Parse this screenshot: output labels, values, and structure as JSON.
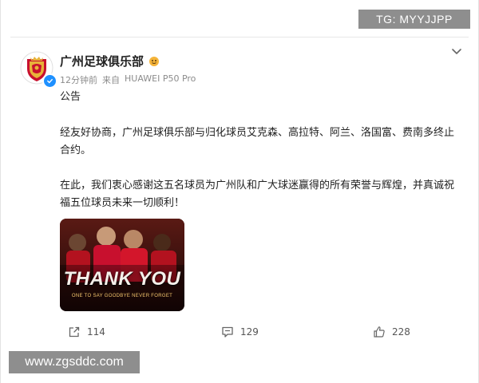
{
  "watermarks": {
    "tg": "TG: MYYJJPP",
    "site": "www.zgsddc.com"
  },
  "post": {
    "username": "广州足球俱乐部",
    "time": "12分钟前",
    "source_prefix": "来自",
    "device": "HUAWEI P50 Pro",
    "title": "公告",
    "paragraph1": "经友好协商，广州足球俱乐部与归化球员艾克森、高拉特、阿兰、洛国富、费南多终止合约。",
    "paragraph2": "在此，我们衷心感谢这五名球员为广州队和广大球迷赢得的所有荣誉与辉煌，并真诚祝福五位球员未来一切顺利！",
    "image": {
      "banner": "THANK YOU",
      "subtitle": "ONE TO SAY GOODBYE   NEVER FORGET"
    }
  },
  "actions": {
    "repost_count": "114",
    "comment_count": "129",
    "like_count": "228"
  },
  "icons": {
    "repost": "share-icon",
    "comment": "comment-icon",
    "like": "thumbs-up-icon",
    "menu": "chevron-down-icon",
    "verified": "verified-badge-icon"
  },
  "colors": {
    "verified_blue": "#1e90ff",
    "club_red": "#c8102e",
    "meta_gray": "#8c8c8c"
  }
}
